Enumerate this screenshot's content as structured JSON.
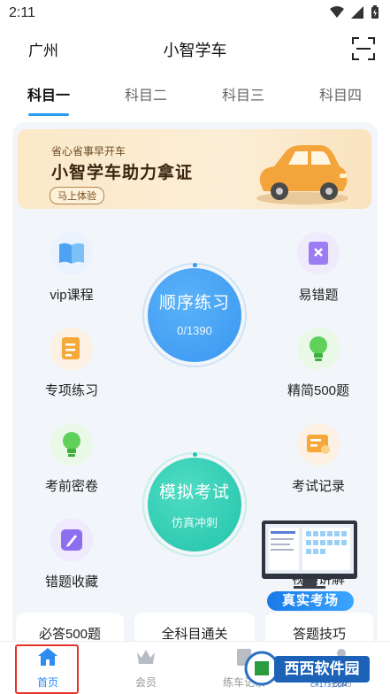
{
  "status": {
    "time": "2:11"
  },
  "header": {
    "city": "广州",
    "title": "小智学车"
  },
  "tabs": [
    {
      "label": "科目一",
      "active": true
    },
    {
      "label": "科目二",
      "active": false
    },
    {
      "label": "科目三",
      "active": false
    },
    {
      "label": "科目四",
      "active": false
    }
  ],
  "banner": {
    "subtitle": "省心省事早开车",
    "title": "小智学车助力拿证",
    "button": "马上体验"
  },
  "features": {
    "vip": "vip课程",
    "mistake_prone": "易错题",
    "special_practice": "专项练习",
    "refined": "精简500题",
    "secret_paper": "考前密卷",
    "exam_record": "考试记录",
    "wrong_collection": "错题收藏",
    "video_explain": "视频讲解"
  },
  "sequential": {
    "title": "顺序练习",
    "progress": "0/1390",
    "done": 0,
    "total": 1390
  },
  "mock_exam": {
    "title": "模拟考试",
    "subtitle": "仿真冲刺"
  },
  "promo": {
    "label": "真实考场"
  },
  "pills": [
    "必答500题",
    "全科目通关",
    "答题技巧"
  ],
  "nav": [
    {
      "label": "首页",
      "icon": "home-icon",
      "active": true
    },
    {
      "label": "会员",
      "icon": "crown-icon",
      "active": false
    },
    {
      "label": "练车记录",
      "icon": "record-icon",
      "active": false
    },
    {
      "label": "我的",
      "icon": "user-icon",
      "active": false
    }
  ],
  "watermark": {
    "brand": "西西软件园",
    "domain": "CR173.COM"
  },
  "colors": {
    "accent": "#2d9bf0",
    "sequential": "#3a9cf5",
    "mock": "#2ccdb3",
    "highlight": "#e2342c"
  }
}
